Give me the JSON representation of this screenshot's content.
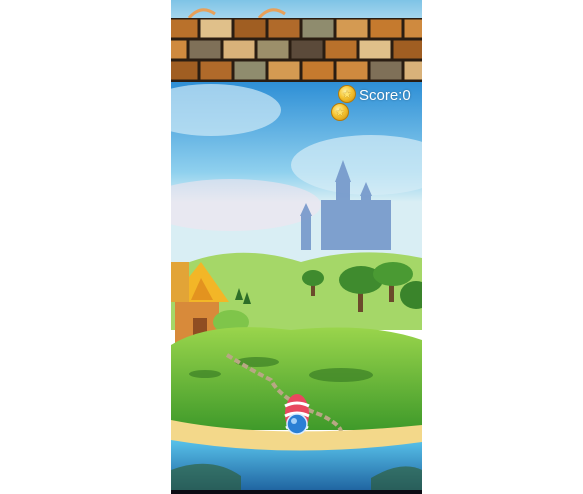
{
  "hud": {
    "score_label": "Score:0",
    "coin_icons": [
      "coin-star-icon",
      "coin-star-icon"
    ]
  },
  "scene": {
    "brick_colors": [
      "#b9712b",
      "#cf8a3f",
      "#a05e22",
      "#d9b27a",
      "#8f8c6e",
      "#5b4a3a",
      "#c57a2e",
      "#e0c08a",
      "#7f7058",
      "#b06a2a",
      "#9c8f6a",
      "#d49a52"
    ],
    "sky_top": "#2e8fd6",
    "sky_mid": "#8fd0ee",
    "grass": "#74c23a",
    "castle": "#6f93c8",
    "sea": "#3aa3d9"
  },
  "launcher": {
    "icon": "candy-bubble-launcher-icon",
    "ball_color": "#2a7fd4",
    "stripe_colors": [
      "#e8485f",
      "#ffffff"
    ]
  }
}
